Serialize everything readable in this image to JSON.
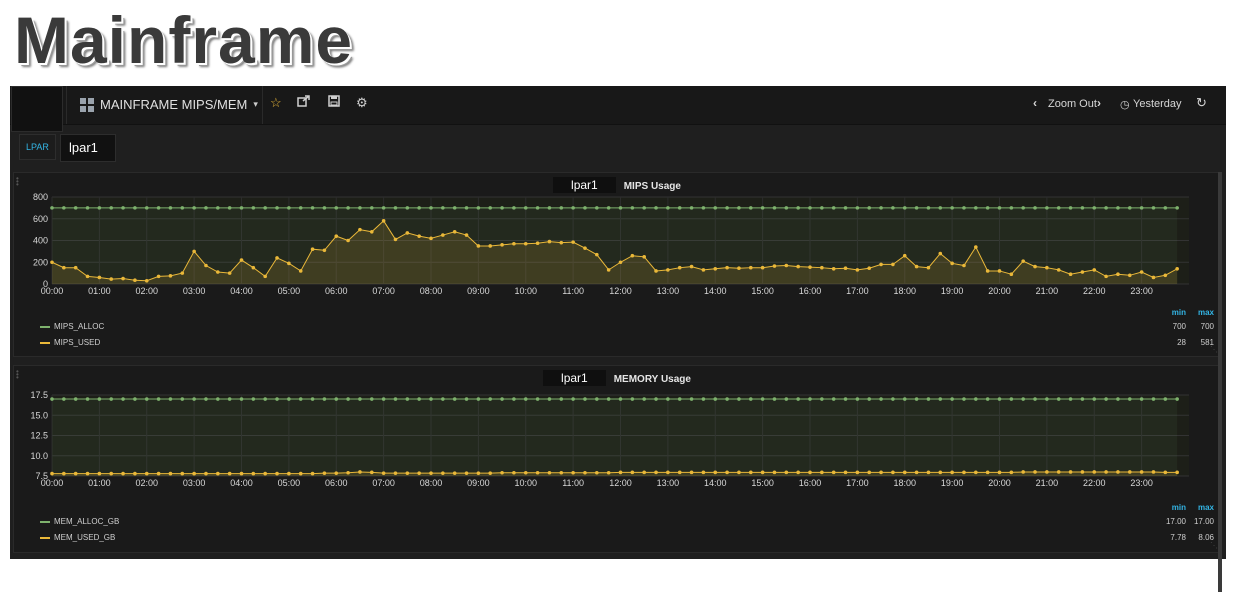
{
  "page_title": "Mainframe",
  "navbar": {
    "dashboard_title": "MAINFRAME MIPS/MEM",
    "zoom_out": "Zoom Out",
    "time_range": "Yesterday",
    "icons": [
      "grid-icon",
      "star-icon",
      "share-icon",
      "save-icon",
      "gear-icon",
      "chevron-left-icon",
      "chevron-right-icon",
      "clock-icon",
      "refresh-icon"
    ]
  },
  "templating": {
    "label": "LPAR",
    "value": "lpar1"
  },
  "colors": {
    "alloc": "#7eb26d",
    "used": "#eab839",
    "accent": "#33b5e5"
  },
  "chart_data": [
    {
      "type": "line",
      "title_var": "lpar1",
      "title": "MIPS Usage",
      "x_ticks": [
        "00:00",
        "01:00",
        "02:00",
        "03:00",
        "04:00",
        "05:00",
        "06:00",
        "07:00",
        "08:00",
        "09:00",
        "10:00",
        "11:00",
        "12:00",
        "13:00",
        "14:00",
        "15:00",
        "16:00",
        "17:00",
        "18:00",
        "19:00",
        "20:00",
        "21:00",
        "22:00",
        "23:00"
      ],
      "y_ticks": [
        "0",
        "200",
        "400",
        "600",
        "800"
      ],
      "ylim": [
        0,
        800
      ],
      "series": [
        {
          "name": "MIPS_ALLOC",
          "values": [
            700,
            700,
            700,
            700,
            700,
            700,
            700,
            700,
            700,
            700,
            700,
            700,
            700,
            700,
            700,
            700,
            700,
            700,
            700,
            700,
            700,
            700,
            700,
            700,
            700,
            700,
            700,
            700,
            700,
            700,
            700,
            700,
            700,
            700,
            700,
            700,
            700,
            700,
            700,
            700,
            700,
            700,
            700,
            700,
            700,
            700,
            700,
            700,
            700,
            700,
            700,
            700,
            700,
            700,
            700,
            700,
            700,
            700,
            700,
            700,
            700,
            700,
            700,
            700,
            700,
            700,
            700,
            700,
            700,
            700,
            700,
            700,
            700,
            700,
            700,
            700,
            700,
            700,
            700,
            700,
            700,
            700,
            700,
            700,
            700,
            700,
            700,
            700,
            700,
            700,
            700,
            700,
            700,
            700,
            700,
            700
          ]
        },
        {
          "name": "MIPS_USED",
          "values": [
            200,
            150,
            150,
            70,
            60,
            45,
            50,
            35,
            30,
            70,
            75,
            100,
            300,
            170,
            110,
            100,
            220,
            150,
            70,
            240,
            190,
            120,
            320,
            310,
            440,
            400,
            500,
            480,
            581,
            410,
            470,
            440,
            420,
            450,
            480,
            450,
            350,
            350,
            360,
            370,
            370,
            375,
            390,
            380,
            385,
            330,
            270,
            130,
            200,
            260,
            250,
            120,
            130,
            150,
            160,
            130,
            140,
            150,
            145,
            150,
            150,
            165,
            170,
            160,
            155,
            150,
            140,
            145,
            130,
            145,
            180,
            180,
            260,
            160,
            150,
            280,
            190,
            170,
            340,
            120,
            120,
            90,
            210,
            160,
            150,
            130,
            90,
            110,
            130,
            70,
            90,
            80,
            110,
            60,
            80,
            140
          ]
        }
      ],
      "legend_stats": {
        "min_label": "min",
        "max_label": "max",
        "rows": [
          {
            "min": "700",
            "max": "700"
          },
          {
            "min": "28",
            "max": "581"
          }
        ]
      }
    },
    {
      "type": "line",
      "title_var": "lpar1",
      "title": "MEMORY Usage",
      "x_ticks": [
        "00:00",
        "01:00",
        "02:00",
        "03:00",
        "04:00",
        "05:00",
        "06:00",
        "07:00",
        "08:00",
        "09:00",
        "10:00",
        "11:00",
        "12:00",
        "13:00",
        "14:00",
        "15:00",
        "16:00",
        "17:00",
        "18:00",
        "19:00",
        "20:00",
        "21:00",
        "22:00",
        "23:00"
      ],
      "y_ticks": [
        "7.5",
        "10.0",
        "12.5",
        "15.0",
        "17.5"
      ],
      "ylim": [
        7.5,
        17.5
      ],
      "series": [
        {
          "name": "MEM_ALLOC_GB",
          "values": [
            17,
            17,
            17,
            17,
            17,
            17,
            17,
            17,
            17,
            17,
            17,
            17,
            17,
            17,
            17,
            17,
            17,
            17,
            17,
            17,
            17,
            17,
            17,
            17,
            17,
            17,
            17,
            17,
            17,
            17,
            17,
            17,
            17,
            17,
            17,
            17,
            17,
            17,
            17,
            17,
            17,
            17,
            17,
            17,
            17,
            17,
            17,
            17,
            17,
            17,
            17,
            17,
            17,
            17,
            17,
            17,
            17,
            17,
            17,
            17,
            17,
            17,
            17,
            17,
            17,
            17,
            17,
            17,
            17,
            17,
            17,
            17,
            17,
            17,
            17,
            17,
            17,
            17,
            17,
            17,
            17,
            17,
            17,
            17,
            17,
            17,
            17,
            17,
            17,
            17,
            17,
            17,
            17,
            17,
            17,
            17
          ]
        },
        {
          "name": "MEM_USED_GB",
          "values": [
            7.8,
            7.8,
            7.8,
            7.8,
            7.8,
            7.8,
            7.8,
            7.8,
            7.8,
            7.8,
            7.8,
            7.8,
            7.8,
            7.8,
            7.8,
            7.8,
            7.8,
            7.8,
            7.8,
            7.8,
            7.8,
            7.8,
            7.8,
            7.85,
            7.85,
            7.9,
            8.0,
            7.95,
            7.85,
            7.85,
            7.85,
            7.85,
            7.85,
            7.85,
            7.85,
            7.85,
            7.85,
            7.85,
            7.9,
            7.9,
            7.9,
            7.9,
            7.9,
            7.9,
            7.9,
            7.9,
            7.9,
            7.9,
            7.95,
            7.95,
            7.95,
            7.95,
            7.95,
            7.95,
            7.95,
            7.95,
            7.95,
            7.95,
            7.95,
            7.95,
            7.95,
            7.95,
            7.95,
            7.95,
            7.95,
            7.95,
            7.95,
            7.95,
            7.95,
            7.95,
            7.95,
            7.95,
            7.95,
            7.95,
            7.95,
            7.95,
            7.95,
            7.95,
            7.95,
            7.95,
            7.95,
            7.95,
            8.0,
            8.0,
            8.0,
            8.0,
            8.0,
            8.0,
            8.0,
            8.0,
            8.0,
            8.0,
            8.0,
            8.0,
            7.95,
            7.95
          ]
        }
      ],
      "legend_stats": {
        "min_label": "min",
        "max_label": "max",
        "rows": [
          {
            "min": "17.00",
            "max": "17.00"
          },
          {
            "min": "7.78",
            "max": "8.06"
          }
        ]
      }
    }
  ]
}
